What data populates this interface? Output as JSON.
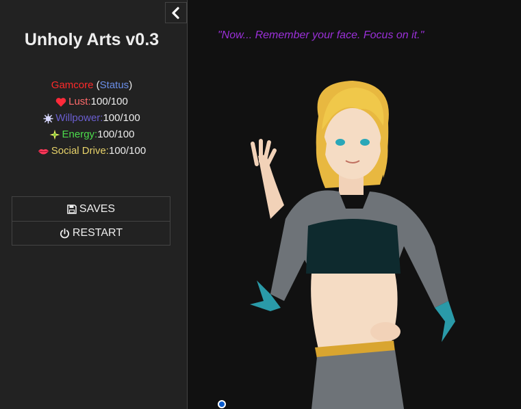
{
  "sidebar": {
    "toggle_icon": "chevron-left-icon",
    "title": "Unholy Arts v0.3",
    "header_line": {
      "player": "Gamcore",
      "open_paren": " (",
      "status_link": "Status",
      "close_paren": ")"
    },
    "stats": [
      {
        "icon": "heart-icon",
        "label": "Lust:",
        "value": "100/100",
        "color": "#ff6b6b"
      },
      {
        "icon": "star-burst-icon",
        "label": "Willpower:",
        "value": "100/100",
        "color": "#6a5ed0"
      },
      {
        "icon": "sparkle-icon",
        "label": "Energy:",
        "value": "100/100",
        "color": "#4cdc4c"
      },
      {
        "icon": "lips-icon",
        "label": "Social Drive:",
        "value": "100/100",
        "color": "#e8d36a"
      }
    ],
    "menu": {
      "saves_label": "SAVES",
      "restart_label": "RESTART"
    }
  },
  "passage": {
    "quote": "\"Now... Remember your face. Focus on it.\"",
    "portrait_alt": "character portrait"
  },
  "colors": {
    "player_name": "#ff2a2a",
    "status_link": "#6a8ee8",
    "quote": "#9b30d9"
  }
}
